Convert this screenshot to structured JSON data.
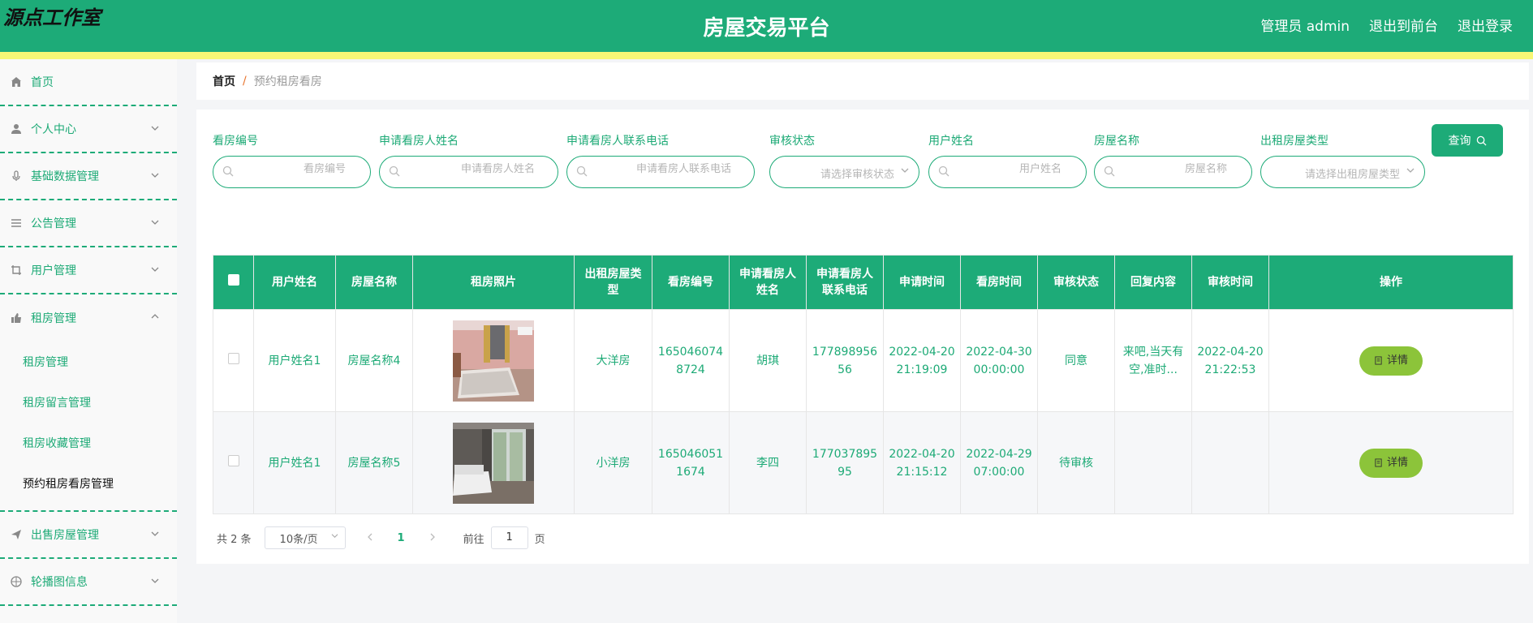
{
  "header": {
    "logo": "源点工作室",
    "title": "房屋交易平台",
    "user_label": "管理员 admin",
    "front_link": "退出到前台",
    "logout_link": "退出登录",
    "bar_color": "#1dab78",
    "stripe_color": "#f7f776"
  },
  "sidebar": {
    "items": [
      {
        "label": "首页",
        "icon": "home-icon"
      },
      {
        "label": "个人中心",
        "icon": "user-icon"
      },
      {
        "label": "基础数据管理",
        "icon": "microphone-icon"
      },
      {
        "label": "公告管理",
        "icon": "list-icon"
      },
      {
        "label": "用户管理",
        "icon": "crop-icon"
      },
      {
        "label": "租房管理",
        "icon": "thumb-up-icon"
      },
      {
        "label": "出售房屋管理",
        "icon": "send-icon"
      },
      {
        "label": "轮播图信息",
        "icon": "globe-icon"
      }
    ],
    "rental_submenu": [
      "租房管理",
      "租房留言管理",
      "租房收藏管理",
      "预约租房看房管理"
    ]
  },
  "breadcrumb": {
    "home": "首页",
    "separator": "/",
    "current": "预约租房看房"
  },
  "filters": {
    "viewing_no": {
      "label": "看房编号",
      "placeholder": "看房编号"
    },
    "applicant_name": {
      "label": "申请看房人姓名",
      "placeholder": "申请看房人姓名"
    },
    "applicant_phone": {
      "label": "申请看房人联系电话",
      "placeholder": "申请看房人联系电话"
    },
    "audit_status": {
      "label": "审核状态",
      "placeholder": "请选择审核状态"
    },
    "user_name": {
      "label": "用户姓名",
      "placeholder": "用户姓名"
    },
    "house_name": {
      "label": "房屋名称",
      "placeholder": "房屋名称"
    },
    "house_type": {
      "label": "出租房屋类型",
      "placeholder": "请选择出租房屋类型"
    },
    "query_button": "查询"
  },
  "table": {
    "columns": [
      "用户姓名",
      "房屋名称",
      "租房照片",
      "出租房屋类型",
      "看房编号",
      "申请看房人姓名",
      "申请看房人联系电话",
      "申请时间",
      "看房时间",
      "审核状态",
      "回复内容",
      "审核时间",
      "操作"
    ],
    "rows": [
      {
        "user_name": "用户姓名1",
        "house_name": "房屋名称4",
        "house_type": "大洋房",
        "viewing_no": "1650460748724",
        "applicant_name": "胡琪",
        "applicant_phone": "17789895656",
        "apply_time": "2022-04-20 21:19:09",
        "viewing_time": "2022-04-30 00:00:00",
        "status": "同意",
        "reply": "来吧,当天有空,准时...",
        "audit_time": "2022-04-20 21:22:53",
        "action": "详情",
        "photo": "bedroom-pink-photo"
      },
      {
        "user_name": "用户姓名1",
        "house_name": "房屋名称5",
        "house_type": "小洋房",
        "viewing_no": "1650460511674",
        "applicant_name": "李四",
        "applicant_phone": "17703789595",
        "apply_time": "2022-04-20 21:15:12",
        "viewing_time": "2022-04-29 07:00:00",
        "status": "待审核",
        "reply": "",
        "audit_time": "",
        "action": "详情",
        "photo": "bedroom-window-photo"
      }
    ]
  },
  "pagination": {
    "total": "共 2 条",
    "page_size": "10条/页",
    "current_page": "1",
    "goto_prefix": "前往",
    "goto_value": "1",
    "goto_suffix": "页"
  }
}
